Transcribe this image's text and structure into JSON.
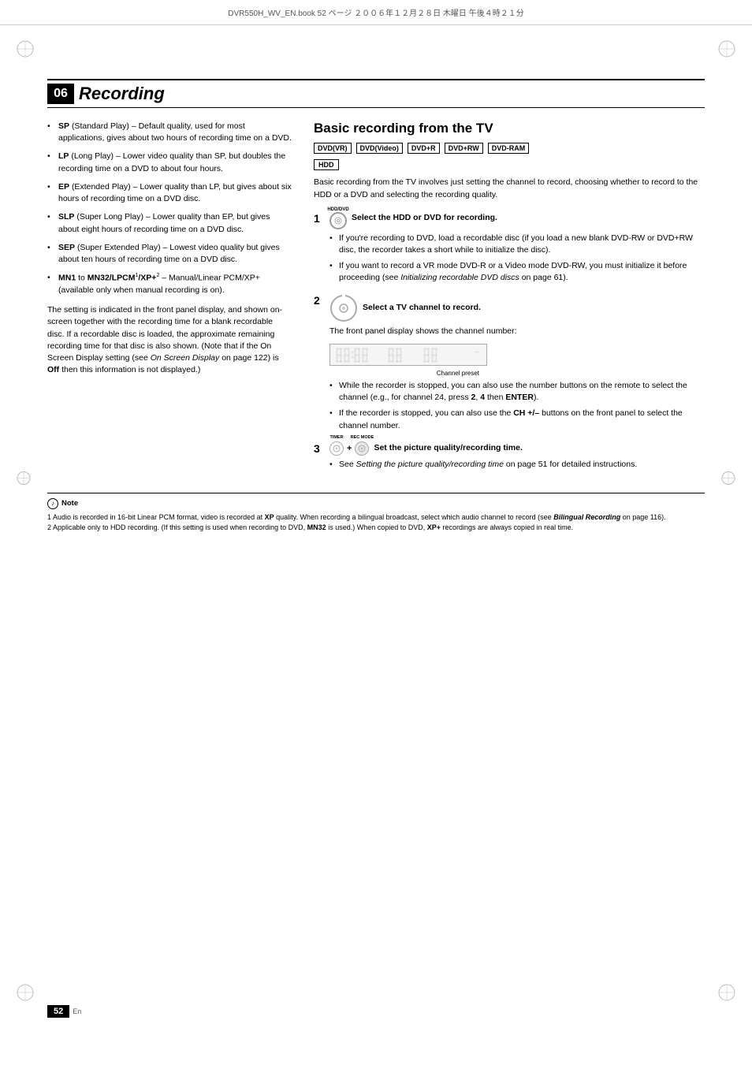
{
  "header": {
    "file_info": "DVR550H_WV_EN.book  52 ページ  ２００６年１２月２８日  木曜日  午後４時２１分"
  },
  "chapter": {
    "number": "06",
    "title": "Recording"
  },
  "left_column": {
    "bullets": [
      {
        "id": "sp",
        "label": "SP",
        "label_full": "SP (Standard Play)",
        "text": " – Default quality, used for most applications, gives about two hours of recording time on a DVD."
      },
      {
        "id": "lp",
        "label": "LP",
        "label_full": "LP (Long Play)",
        "text": " – Lower video quality than SP, but doubles the recording time on a DVD to about four hours."
      },
      {
        "id": "ep",
        "label": "EP",
        "label_full": "EP (Extended Play)",
        "text": " – Lower quality than LP, but gives about six hours of recording time on a DVD disc."
      },
      {
        "id": "slp",
        "label": "SLP",
        "label_full": "SLP (Super Long Play)",
        "text": " – Lower quality than EP, but gives about eight hours of recording time on a DVD disc."
      },
      {
        "id": "sep",
        "label": "SEP",
        "label_full": "SEP (Super Extended Play)",
        "text": " – Lowest video quality but gives about ten hours of recording time on a DVD disc."
      },
      {
        "id": "mn",
        "label": "MN1",
        "text_part1": " to ",
        "label2": "MN32",
        "label2_super": "",
        "label3": "LPCM",
        "label3_super": "1",
        "label4": "XP+",
        "label4_super": "2",
        "text": " – Manual/Linear PCM/XP+ (available only when manual recording is on)."
      }
    ],
    "paragraph": "The setting is indicated in the front panel display, and shown on-screen together with the recording time for a blank recordable disc. If a recordable disc is loaded, the approximate remaining recording time for that disc is also shown. (Note that if the On Screen Display setting (see On Screen Display on page 122) is Off then this information is not displayed.)",
    "off_label": "Off"
  },
  "right_column": {
    "section_title": "Basic recording from the TV",
    "format_badges": [
      "DVD(VR)",
      "DVD(Video)",
      "DVD+R",
      "DVD+RW",
      "DVD-RAM"
    ],
    "hdd_badge": "HDD",
    "description": "Basic recording from the TV involves just setting the channel to record, choosing whether to record to the HDD or a DVD and selecting the recording quality.",
    "steps": [
      {
        "num": "1",
        "icon_label": "HDD/DVD",
        "title": "Select the HDD or DVD for recording.",
        "bullets": [
          "If you're recording to DVD, load a recordable disc (if you load a new blank DVD-RW or DVD+RW disc, the recorder takes a short while to initialize the disc).",
          "If you want to record a VR mode DVD-R or a Video mode DVD-RW, you must initialize it before proceeding (see Initializing recordable DVD discs on page 61)."
        ],
        "italic_ref": "Initializing recordable DVD discs",
        "page_ref": "page 61"
      },
      {
        "num": "2",
        "title": "Select a TV channel to record.",
        "body": "The front panel display shows the channel number:",
        "channel_preset_label": "Channel preset",
        "bullets": [
          "While the recorder is stopped, you can also use the number buttons on the remote to select the channel (e.g., for channel 24, press 2, 4 then ENTER).",
          "If the recorder is stopped, you can also use the CH +/– buttons on the front panel to select the channel number."
        ],
        "key2": "2",
        "key4": "4",
        "enter_key": "ENTER",
        "ch_key": "CH +/–"
      },
      {
        "num": "3",
        "icon1_label": "TIMER",
        "icon2_label": "REC MODE",
        "title": "Set the picture quality/recording time.",
        "bullets": [
          "See Setting the picture quality/recording time on page 51 for detailed instructions."
        ],
        "italic_ref": "Setting the picture quality/recording time",
        "page_ref": "page 51"
      }
    ]
  },
  "note": {
    "label": "Note",
    "items": [
      "1 Audio is recorded in 16-bit Linear PCM format, video is recorded at XP quality. When recording a bilingual broadcast, select which audio channel to record (see Bilingual Recording on page 116).",
      "2 Applicable only to HDD recording. (If this setting is used when recording to DVD, MN32 is used.) When copied to DVD, XP+ recordings are always copied in real time."
    ],
    "xp_label": "XP",
    "bilingual_ref": "Bilingual Recording",
    "page116": "page 116",
    "mn32_label": "MN32",
    "xpplus_label": "XP+"
  },
  "footer": {
    "page_number": "52",
    "language": "En"
  }
}
